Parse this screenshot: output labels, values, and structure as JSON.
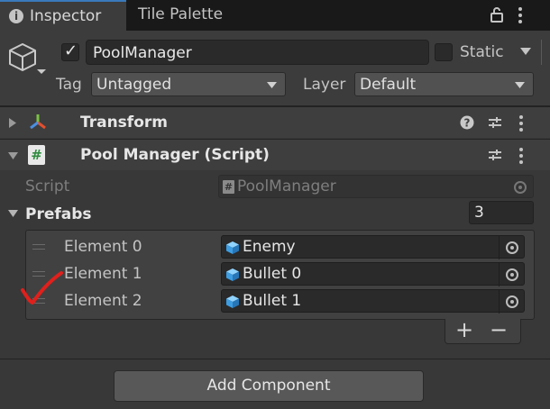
{
  "tabs": [
    {
      "label": "Inspector",
      "icon": "info-icon",
      "active": true
    },
    {
      "label": "Tile Palette",
      "active": false
    }
  ],
  "header": {
    "object_name": "PoolManager",
    "active_checked": true,
    "static_label": "Static",
    "static_checked": false,
    "tag_label": "Tag",
    "tag_value": "Untagged",
    "layer_label": "Layer",
    "layer_value": "Default",
    "icons": [
      "gameobject-cube-icon",
      "lock-icon",
      "more-icon"
    ]
  },
  "components": [
    {
      "title": "Transform",
      "expanded": false,
      "icon": "transform-axes-icon"
    },
    {
      "title": "Pool Manager (Script)",
      "expanded": true,
      "icon": "csharp-script-icon"
    }
  ],
  "script_field": {
    "label": "Script",
    "value": "PoolManager"
  },
  "prefabs": {
    "label": "Prefabs",
    "size": "3",
    "elements": [
      {
        "label": "Element 0",
        "value": "Enemy"
      },
      {
        "label": "Element 1",
        "value": "Bullet 0"
      },
      {
        "label": "Element 2",
        "value": "Bullet 1"
      }
    ],
    "add_label": "+",
    "remove_label": "−"
  },
  "add_component_label": "Add Component",
  "annotation": {
    "color": "#e0201c"
  }
}
